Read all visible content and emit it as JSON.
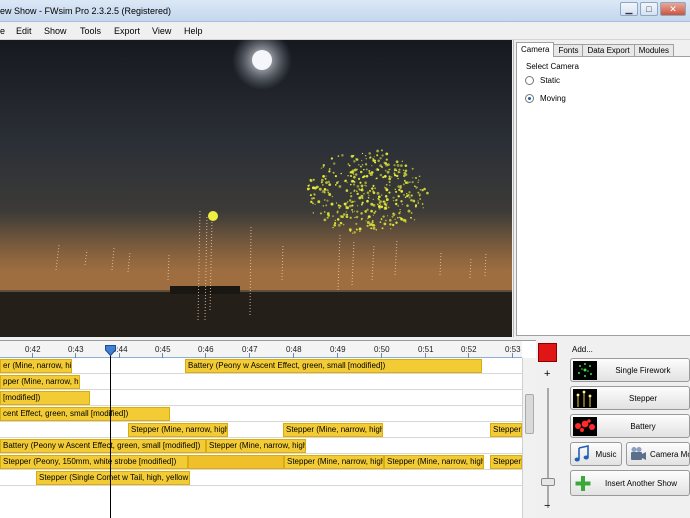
{
  "window": {
    "title": "ew Show - FWsim Pro 2.3.2.5 (Registered)",
    "minimize_icon": "minimize-icon",
    "maximize_icon": "maximize-icon",
    "close_icon": "close-icon"
  },
  "menu": [
    "e",
    "Edit",
    "Show",
    "Tools",
    "Export",
    "View",
    "Help"
  ],
  "right_panel": {
    "tabs": [
      "Camera",
      "Fonts",
      "Data Export",
      "Modules"
    ],
    "active_tab": "Camera",
    "group_label": "Select Camera",
    "options": [
      {
        "label": "Static",
        "checked": false
      },
      {
        "label": "Moving",
        "checked": true
      }
    ]
  },
  "timeline": {
    "tick_labels": [
      "0:42",
      "0:43",
      "0:44",
      "0:45",
      "0:46",
      "0:47",
      "0:48",
      "0:49",
      "0:50",
      "0:51",
      "0:52",
      "0:53"
    ],
    "tracks": [
      {
        "clips": [
          {
            "text": "er (Mine, narrow, high"
          },
          {
            "text": "Battery (Peony w Ascent Effect, green, small [modified])"
          }
        ]
      },
      {
        "clips": [
          {
            "text": "pper (Mine, narrow, high"
          }
        ]
      },
      {
        "clips": [
          {
            "text": "[modified])"
          }
        ]
      },
      {
        "clips": [
          {
            "text": "cent Effect, green, small [modified])"
          }
        ]
      },
      {
        "clips": [
          {
            "text": "Stepper (Mine, narrow, high"
          },
          {
            "text": "Stepper (Mine, narrow, high"
          },
          {
            "text": "Stepper (Mine, narrow, high"
          },
          {
            "text": "Stepper"
          }
        ]
      },
      {
        "clips": [
          {
            "text": "Battery (Peony w Ascent Effect, green, small [modified])"
          },
          {
            "text": "Stepper (Mine, narrow, high"
          }
        ]
      },
      {
        "clips": [
          {
            "text": "Stepper (Peony, 150mm, white strobe [modified])"
          },
          {
            "text": "Stepper (Mine, narrow, high"
          },
          {
            "text": "Stepper (Mine, narrow, high"
          },
          {
            "text": "Stepper (I"
          }
        ]
      },
      {
        "clips": [
          {
            "text": "Stepper (Single Comet w Tail, high, yellow [n"
          }
        ]
      }
    ]
  },
  "zoom": {
    "plus": "+",
    "minus": "−"
  },
  "add_panel": {
    "label": "Add...",
    "buttons": [
      {
        "label": "Single Firework",
        "icon": "firework-thumbnail-icon"
      },
      {
        "label": "Stepper",
        "icon": "stepper-thumbnail-icon"
      },
      {
        "label": "Battery",
        "icon": "battery-thumbnail-icon"
      },
      {
        "label": "Music",
        "icon": "music-note-icon"
      },
      {
        "label": "Camera Mo",
        "icon": "camera-icon"
      },
      {
        "label": "Insert Another Show",
        "icon": "plus-icon"
      }
    ]
  },
  "colors": {
    "clip_fill": "#f3cc35",
    "record": "#e01616",
    "firework_burst": "#ecf23a"
  }
}
